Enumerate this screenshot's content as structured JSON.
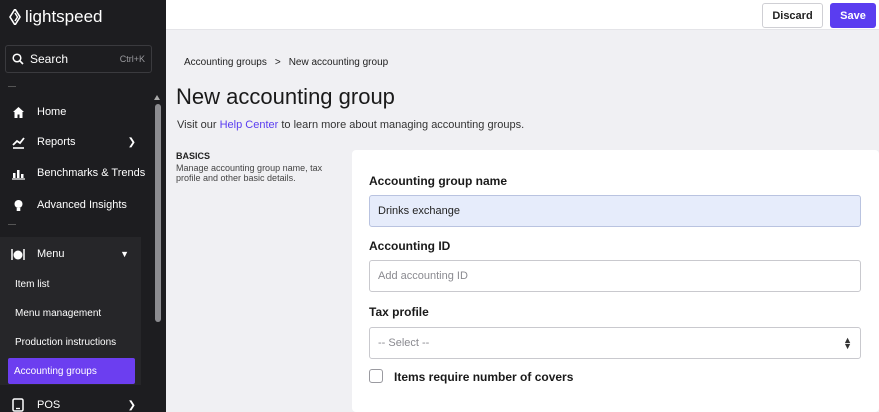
{
  "app": {
    "logo_text": "lightspeed"
  },
  "sidebar": {
    "search_label": "Search",
    "search_shortcut": "Ctrl+K",
    "items": [
      {
        "label": "Home",
        "icon": "home-icon"
      },
      {
        "label": "Reports",
        "icon": "reports-icon"
      },
      {
        "label": "Benchmarks & Trends",
        "icon": "benchmarks-icon"
      },
      {
        "label": "Advanced Insights",
        "icon": "lightbulb-icon"
      },
      {
        "label": "Menu",
        "icon": "menu-icon"
      },
      {
        "label": "POS",
        "icon": "pos-icon"
      }
    ],
    "menu_sub": [
      "Item list",
      "Menu management",
      "Production instructions",
      "Accounting groups"
    ]
  },
  "toolbar": {
    "discard_label": "Discard",
    "save_label": "Save"
  },
  "breadcrumb": {
    "parent": "Accounting groups",
    "separator": ">",
    "current": "New accounting group"
  },
  "page": {
    "title": "New accounting group",
    "help_prefix": "Visit our",
    "help_link": "Help Center",
    "help_suffix": "to learn more about managing accounting groups."
  },
  "basics": {
    "title": "BASICS",
    "description": "Manage accounting group name, tax profile and other basic details."
  },
  "form": {
    "name_label": "Accounting group name",
    "name_value": "Drinks exchange",
    "id_label": "Accounting ID",
    "id_placeholder": "Add accounting ID",
    "tax_label": "Tax profile",
    "tax_value": "-- Select --",
    "covers_label": "Items require number of covers"
  },
  "colors": {
    "accent": "#5a3df0",
    "sidebar_bg": "#1d1d20",
    "active_item": "#6c3ef0"
  }
}
